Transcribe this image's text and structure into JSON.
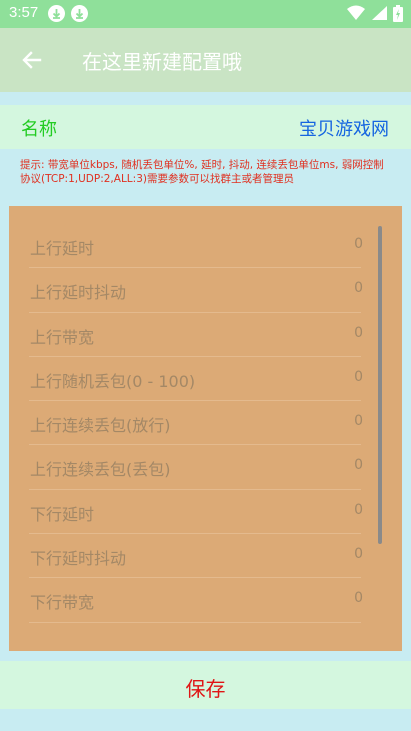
{
  "status_bar": {
    "time": "3:57",
    "icons": [
      "download-icon",
      "download-icon",
      "wifi-icon",
      "signal-icon",
      "battery-charging-icon"
    ]
  },
  "app_bar": {
    "back_icon": "arrow-left-icon",
    "title": "在这里新建配置哦"
  },
  "name_row": {
    "label": "名称",
    "value": "宝贝游戏网"
  },
  "hint": "提示: 带宽单位kbps, 随机丢包单位%, 延时, 抖动, 连续丢包单位ms, 弱网控制协议(TCP:1,UDP:2,ALL:3)需要参数可以找群主或者管理员",
  "settings": [
    {
      "label": "上行延时",
      "value": "0"
    },
    {
      "label": "上行延时抖动",
      "value": "0"
    },
    {
      "label": "上行带宽",
      "value": "0"
    },
    {
      "label": "上行随机丢包(0 - 100)",
      "value": "0"
    },
    {
      "label": "上行连续丢包(放行)",
      "value": "0"
    },
    {
      "label": "上行连续丢包(丢包)",
      "value": "0"
    },
    {
      "label": "下行延时",
      "value": "0"
    },
    {
      "label": "下行延时抖动",
      "value": "0"
    },
    {
      "label": "下行带宽",
      "value": "0"
    }
  ],
  "save_button": "保存",
  "colors": {
    "status_bar": "#8fe09a",
    "app_bar": "#c9e4c4",
    "page_background": "#c8ecf2",
    "panel": "#dcaa76",
    "name_label": "#22cc22",
    "name_value": "#1565e0",
    "hint_text": "#e03020",
    "save_text": "#e01515"
  }
}
